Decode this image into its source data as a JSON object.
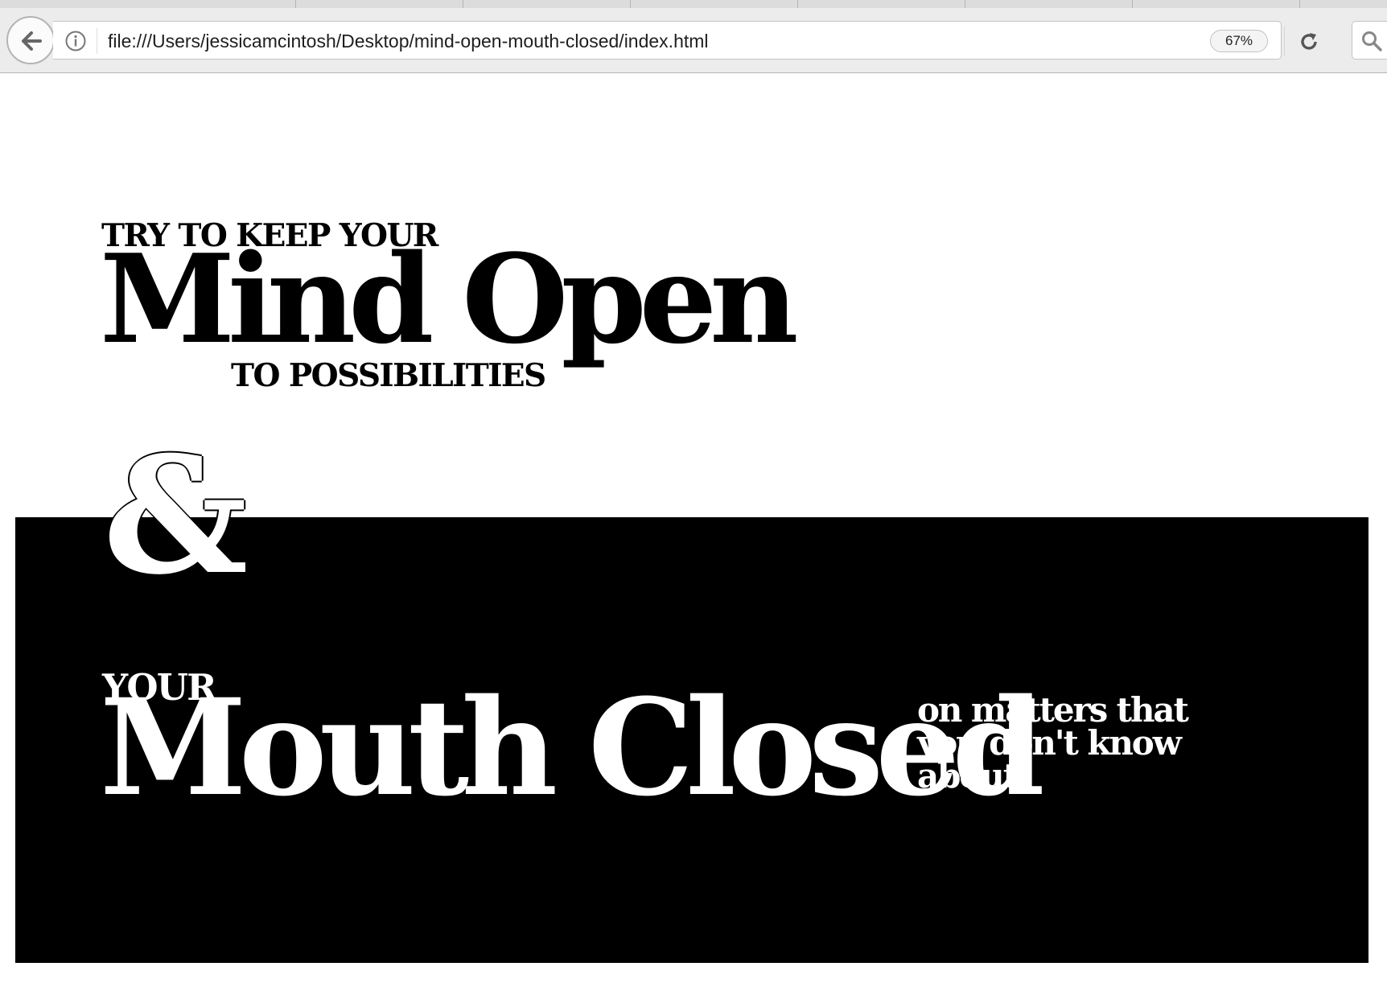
{
  "browser": {
    "url": "file:///Users/jessicamcintosh/Desktop/mind-open-mouth-closed/index.html",
    "zoom": "67%",
    "icons": [
      "back-arrow-icon",
      "info-icon",
      "reload-icon",
      "search-icon"
    ]
  },
  "poster": {
    "line1": "TRY TO KEEP YOUR",
    "headline1": "Mind Open",
    "line2": "TO POSSIBILITIES",
    "ampersand": "&",
    "line3": "YOUR",
    "headline2": "Mouth Closed",
    "tail": [
      "on matters that",
      "you don't know",
      "about"
    ]
  },
  "colors": {
    "page": "#ffffff",
    "panel": "#000000",
    "text_dark": "#000000",
    "text_light": "#ffffff"
  }
}
